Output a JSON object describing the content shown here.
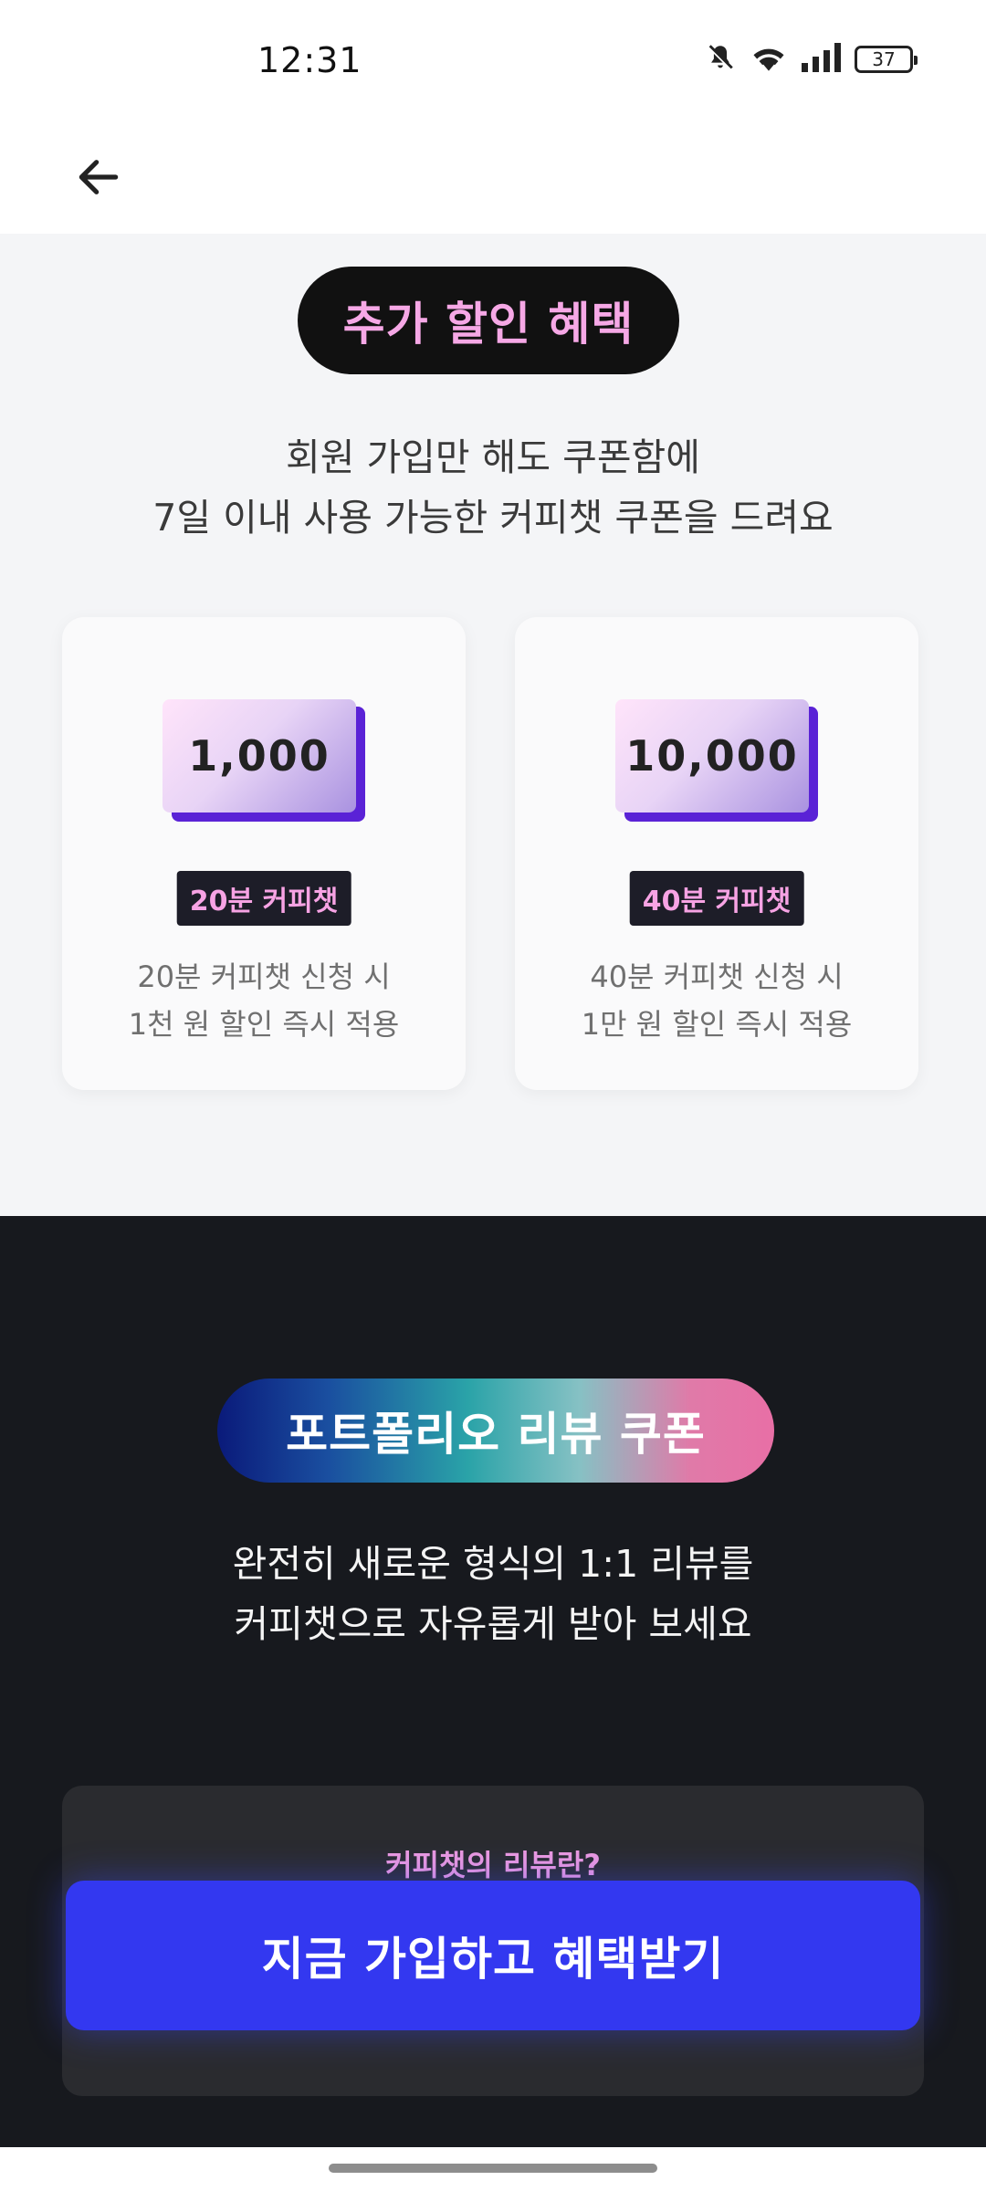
{
  "status_bar": {
    "time": "12:31",
    "battery": "37",
    "icons": [
      "mute-icon",
      "wifi-icon",
      "signal-icon",
      "battery-icon"
    ]
  },
  "nav": {
    "back_icon": "arrow-left-icon"
  },
  "discount_section": {
    "badge": "추가 할인 혜택",
    "desc_line1": "회원 가입만 해도 쿠폰함에",
    "desc_line2": "7일 이내 사용 가능한 커피챗 쿠폰을 드려요",
    "coupons": [
      {
        "amount": "1,000",
        "tag": "20분 커피챗",
        "desc_line1": "20분 커피챗 신청 시",
        "desc_line2": "1천 원 할인 즉시 적용"
      },
      {
        "amount": "10,000",
        "tag": "40분 커피챗",
        "desc_line1": "40분 커피챗 신청 시",
        "desc_line2": "1만 원 할인 즉시 적용"
      }
    ]
  },
  "portfolio_section": {
    "badge": "포트폴리오 리뷰 쿠폰",
    "desc_line1": "완전히 새로운 형식의 1:1 리뷰를",
    "desc_line2": "커피챗으로 자유롭게 받아 보세요",
    "review_title": "커피챗의 리뷰란?"
  },
  "cta": {
    "label": "지금 가입하고 혜택받기"
  },
  "colors": {
    "accent_blue": "#3338f0",
    "pink": "#f6a8e6",
    "dark_bg": "#17191e",
    "light_bg": "#f4f5f7"
  }
}
